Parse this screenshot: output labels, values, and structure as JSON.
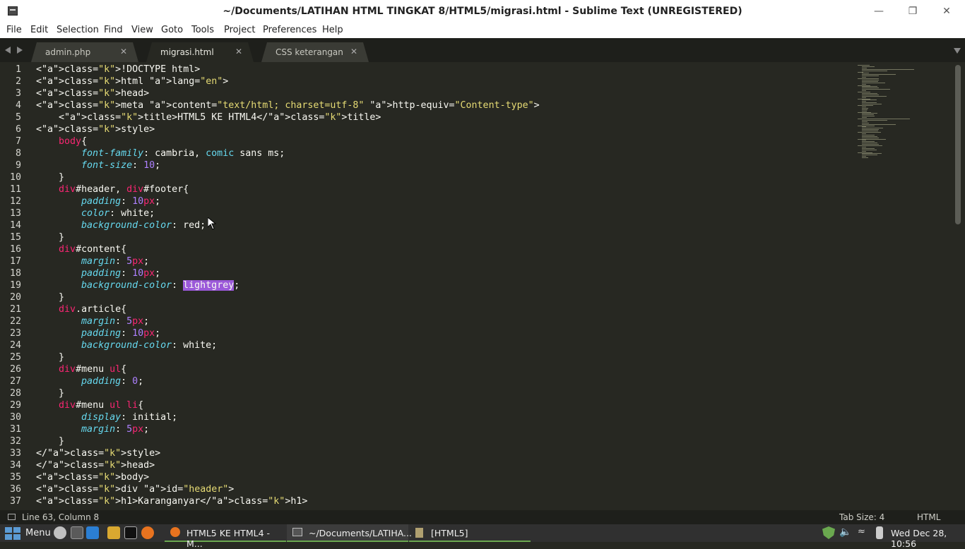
{
  "window": {
    "title": "~/Documents/LATIHAN HTML TINGKAT 8/HTML5/migrasi.html - Sublime Text (UNREGISTERED)"
  },
  "menu": [
    "File",
    "Edit",
    "Selection",
    "Find",
    "View",
    "Goto",
    "Tools",
    "Project",
    "Preferences",
    "Help"
  ],
  "tabs": [
    {
      "label": "admin.php",
      "active": false
    },
    {
      "label": "migrasi.html",
      "active": true
    },
    {
      "label": "CSS keterangan",
      "active": false
    }
  ],
  "code": {
    "line_numbers": [
      "1",
      "2",
      "3",
      "4",
      "5",
      "6",
      "7",
      "8",
      "9",
      "10",
      "11",
      "12",
      "13",
      "14",
      "15",
      "16",
      "17",
      "18",
      "19",
      "20",
      "21",
      "22",
      "23",
      "24",
      "25",
      "26",
      "27",
      "28",
      "29",
      "30",
      "31",
      "32",
      "33",
      "34",
      "35",
      "36",
      "37"
    ],
    "lines": [
      "<!DOCTYPE html>",
      "<html lang=\"en\">",
      "<head>",
      "<meta content=\"text/html; charset=utf-8\" http-equiv=\"Content-type\">",
      "    <title>HTML5 KE HTML4</title>",
      "<style>",
      "    body{",
      "        font-family: cambria, comic sans ms;",
      "        font-size: 10;",
      "    }",
      "    div#header, div#footer{",
      "        padding: 10px;",
      "        color: white;",
      "        background-color: red;",
      "    }",
      "    div#content{",
      "        margin: 5px;",
      "        padding: 10px;",
      "        background-color: lightgrey;",
      "    }",
      "    div.article{",
      "        margin: 5px;",
      "        padding: 10px;",
      "        background-color: white;",
      "    }",
      "    div#menu ul{",
      "        padding: 0;",
      "    }",
      "    div#menu ul li{",
      "        display: initial;",
      "        margin: 5px;",
      "    }",
      "</style>",
      "</head>",
      "<body>",
      "<div id=\"header\">",
      "<h1>Karanganyar</h1>"
    ]
  },
  "status": {
    "position": "Line 63, Column 8",
    "tab_size": "Tab Size: 4",
    "syntax": "HTML"
  },
  "taskbar": {
    "menu_label": "Menu",
    "tasks": [
      "HTML5 KE HTML4 - M...",
      "~/Documents/LATIHA...",
      "[HTML5]"
    ],
    "clock": "Wed Dec 28, 10:56"
  },
  "colors": {
    "tag": "#f92672",
    "string": "#e6db74",
    "attr": "#a6e22e",
    "property": "#66d9ef",
    "number": "#ae81ff",
    "selection": "#9b59d9"
  }
}
